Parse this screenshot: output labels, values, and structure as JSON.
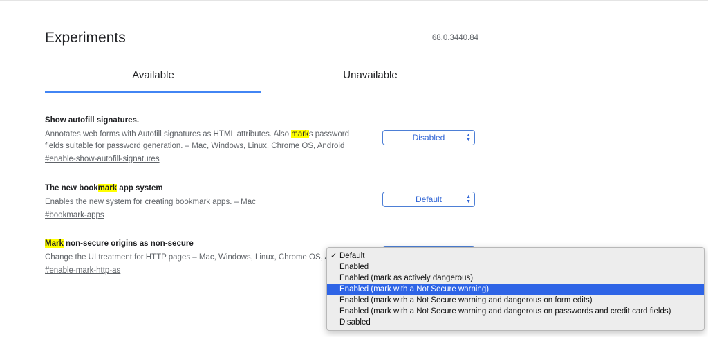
{
  "page": {
    "title": "Experiments",
    "version": "68.0.3440.84"
  },
  "tabs": [
    {
      "label": "Available"
    },
    {
      "label": "Unavailable"
    }
  ],
  "experiments": [
    {
      "title": "Show autofill signatures.",
      "desc_before": "Annotates web forms with Autofill signatures as HTML attributes. Also ",
      "desc_highlight": "mark",
      "desc_after": "s password fields suitable for password generation. – Mac, Windows, Linux, Chrome OS, Android",
      "link": "#enable-show-autofill-signatures",
      "select_value": "Disabled"
    },
    {
      "title_before": "The new book",
      "title_highlight": "mark",
      "title_after": " app system",
      "desc": "Enables the new system for creating bookmark apps. – Mac",
      "link": "#bookmark-apps",
      "select_value": "Default"
    },
    {
      "title_highlight": "Mark",
      "title_after": " non-secure origins as non-secure",
      "desc": "Change the UI treatment for HTTP pages – Mac, Windows, Linux, Chrome OS, A",
      "link": "#enable-mark-http-as"
    }
  ],
  "dropdown": {
    "check": "✓",
    "options": [
      "Default",
      "Enabled",
      "Enabled (mark as actively dangerous)",
      "Enabled (mark with a Not Secure warning)",
      "Enabled (mark with a Not Secure warning and dangerous on form edits)",
      "Enabled (mark with a Not Secure warning and dangerous on passwords and credit card fields)",
      "Disabled"
    ],
    "checked_index": 0,
    "highlighted_index": 3
  },
  "icons": {
    "select_arrows": "updown-arrows-icon",
    "check": "checkmark-icon"
  },
  "colors": {
    "accent": "#4285f4",
    "select_text": "#3367d6",
    "highlight": "#ffff00",
    "menu_selected": "#2e64e6"
  }
}
